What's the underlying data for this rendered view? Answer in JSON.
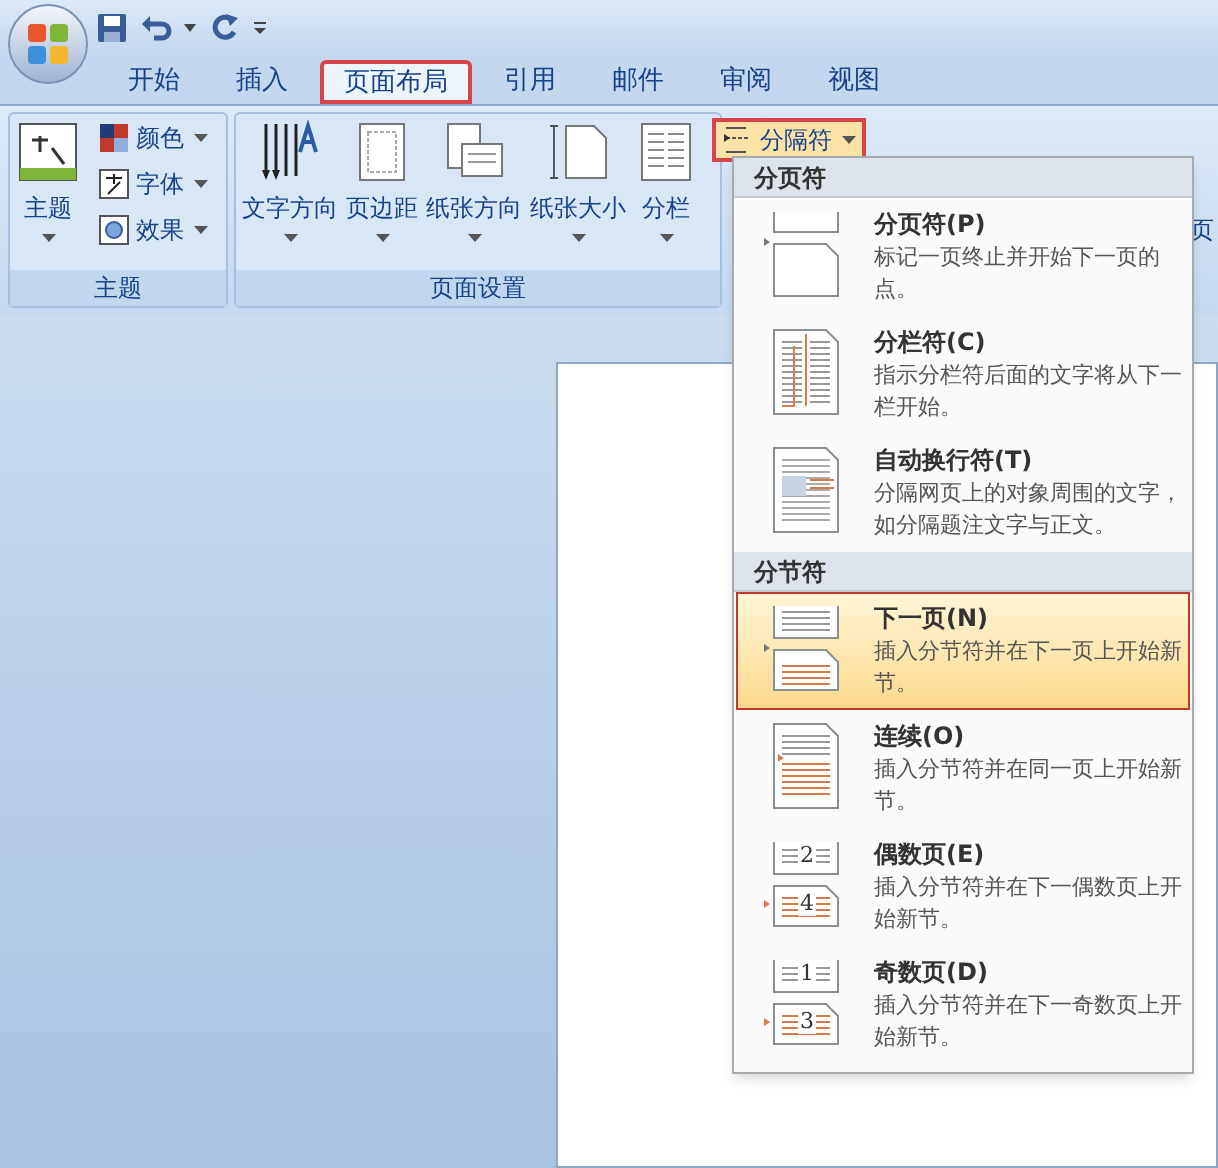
{
  "tabs": [
    {
      "label": "开始",
      "selected": false
    },
    {
      "label": "插入",
      "selected": false
    },
    {
      "label": "页面布局",
      "selected": true
    },
    {
      "label": "引用",
      "selected": false
    },
    {
      "label": "邮件",
      "selected": false
    },
    {
      "label": "审阅",
      "selected": false
    },
    {
      "label": "视图",
      "selected": false
    }
  ],
  "ribbon": {
    "groups": [
      {
        "title": "主题",
        "large": [
          {
            "label": "主题",
            "kind": "theme"
          }
        ],
        "small": [
          {
            "label": "颜色",
            "kind": "colors",
            "pressed": false
          },
          {
            "label": "字体",
            "kind": "fonts",
            "pressed": false
          },
          {
            "label": "效果",
            "kind": "effects",
            "pressed": false
          }
        ]
      },
      {
        "title": "页面设置",
        "large": [
          {
            "label": "文字方向",
            "kind": "text_direction"
          },
          {
            "label": "页边距",
            "kind": "margins"
          },
          {
            "label": "纸张方向",
            "kind": "orientation"
          },
          {
            "label": "纸张大小",
            "kind": "size"
          },
          {
            "label": "分栏",
            "kind": "columns"
          }
        ],
        "small": [
          {
            "label": "分隔符",
            "kind": "breaks",
            "pressed": true
          }
        ]
      }
    ],
    "cut_label": "页"
  },
  "breaks_menu": {
    "sections": [
      {
        "title": "分页符",
        "items": [
          {
            "title": "分页符(P)",
            "description": "标记一页终止并开始下一页的点。",
            "kind": "page_break",
            "selected": false
          },
          {
            "title": "分栏符(C)",
            "description": "指示分栏符后面的文字将从下一栏开始。",
            "kind": "column_break",
            "selected": false
          },
          {
            "title": "自动换行符(T)",
            "description": "分隔网页上的对象周围的文字，如分隔题注文字与正文。",
            "kind": "text_wrapping",
            "selected": false
          }
        ]
      },
      {
        "title": "分节符",
        "items": [
          {
            "title": "下一页(N)",
            "description": "插入分节符并在下一页上开始新节。",
            "kind": "next_page",
            "selected": true
          },
          {
            "title": "连续(O)",
            "description": "插入分节符并在同一页上开始新节。",
            "kind": "continuous",
            "selected": false
          },
          {
            "title": "偶数页(E)",
            "description": "插入分节符并在下一偶数页上开始新节。",
            "kind": "numbered",
            "numbers": [
              "2",
              "4"
            ],
            "selected": false
          },
          {
            "title": "奇数页(D)",
            "description": "插入分节符并在下一奇数页上开始新节。",
            "kind": "numbered",
            "numbers": [
              "1",
              "3"
            ],
            "selected": false
          }
        ]
      }
    ]
  }
}
